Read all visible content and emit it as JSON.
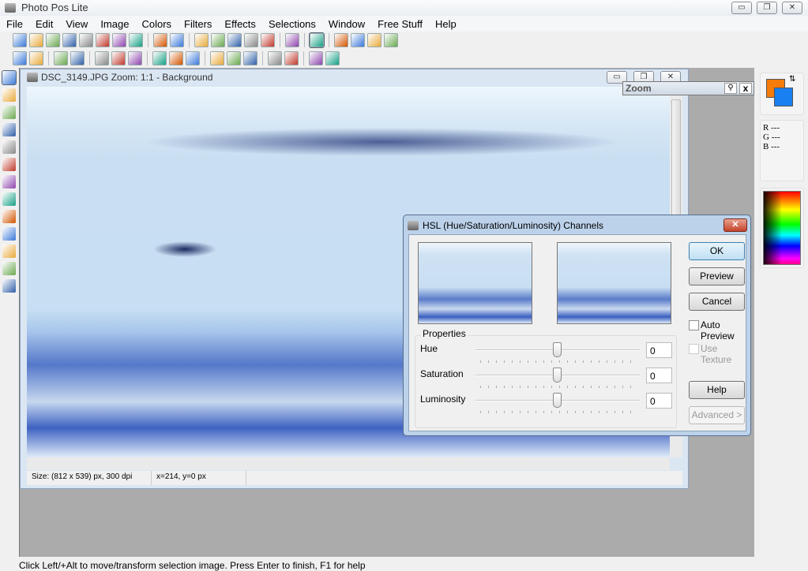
{
  "app": {
    "title": "Photo Pos Lite"
  },
  "window_controls": {
    "minimize": "▭",
    "maximize": "❐",
    "close": "✕"
  },
  "menu": [
    "File",
    "Edit",
    "View",
    "Image",
    "Colors",
    "Filters",
    "Effects",
    "Selections",
    "Window",
    "Free Stuff",
    "Help"
  ],
  "toolbar1": [
    "new",
    "open",
    "browse",
    "save",
    "save-all",
    "print",
    "print-preview",
    "camera",
    "|",
    "undo",
    "redo",
    "|",
    "cut",
    "copy",
    "paste",
    "paste-new",
    "screen-capture",
    "|",
    "batch",
    "|",
    "tools",
    "|",
    "grid",
    "layers",
    "window",
    "ruler"
  ],
  "toolbar2": [
    "rotate-left",
    "rotate-right",
    "|",
    "flip-horizontal",
    "flip-vertical",
    "|",
    "brightness",
    "color-balance",
    "levels",
    "|",
    "add-layer",
    "layer-properties",
    "red-eye",
    "|",
    "image",
    "histogram",
    "sort",
    "|",
    "frame",
    "info",
    "|",
    "lightning",
    "star"
  ],
  "tools": [
    "move",
    "zoom",
    "select-rect",
    "magic-wand",
    "crop",
    "eyedropper",
    "brush",
    "clone",
    "gradient",
    "shape",
    "fill",
    "text",
    "eraser"
  ],
  "document": {
    "title": "DSC_3149.JPG  Zoom: 1:1 - Background",
    "size": "Size: (812 x 539) px, 300 dpi",
    "coords": "x=214, y=0 px"
  },
  "zoom_panel": {
    "title": "Zoom",
    "close": "x"
  },
  "colors": {
    "foreground": "#f57b0a",
    "background": "#1a7ff0",
    "r": "R ---",
    "g": "G ---",
    "b": "B ---"
  },
  "status": "Click Left/+Alt to move/transform selection image. Press Enter to finish, F1 for help",
  "dialog": {
    "title": "HSL (Hue/Saturation/Luminosity) Channels",
    "close": "✕",
    "properties": "Properties",
    "sliders": [
      {
        "label": "Hue",
        "value": "0"
      },
      {
        "label": "Saturation",
        "value": "0"
      },
      {
        "label": "Luminosity",
        "value": "0"
      }
    ],
    "ok": "OK",
    "preview": "Preview",
    "cancel": "Cancel",
    "auto_preview": "Auto Preview",
    "use_texture": "Use Texture",
    "help": "Help",
    "advanced": "Advanced >"
  }
}
